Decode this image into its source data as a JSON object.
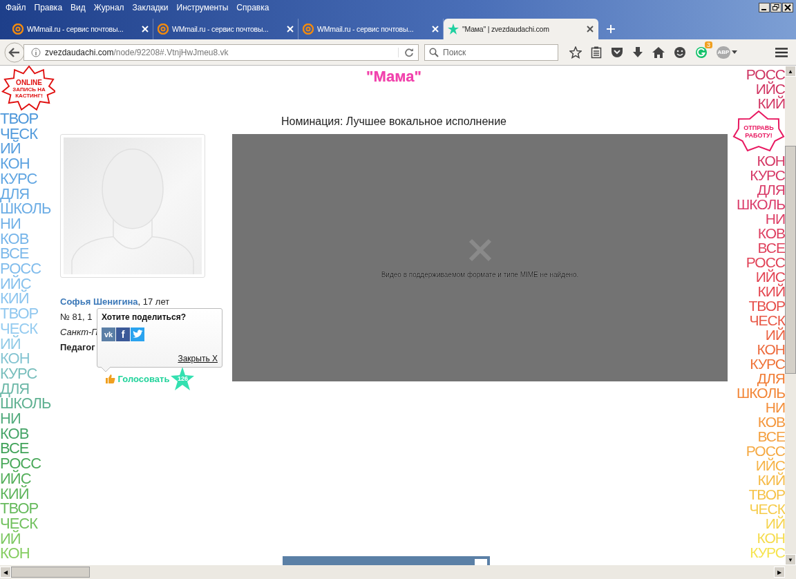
{
  "menu": [
    "Файл",
    "Правка",
    "Вид",
    "Журнал",
    "Закладки",
    "Инструменты",
    "Справка"
  ],
  "tabs": [
    {
      "title": "WMmail.ru - сервис почтовы...",
      "kind": "mail",
      "selected": false
    },
    {
      "title": "WMmail.ru - сервис почтовы...",
      "kind": "mail",
      "selected": false
    },
    {
      "title": "WMmail.ru - сервис почтовы...",
      "kind": "mail",
      "selected": false
    },
    {
      "title": "\"Мама\" | zvezdaudachi.com",
      "kind": "star",
      "selected": true
    }
  ],
  "address": {
    "host": "zvezdaudachi.com",
    "path": "/node/92208#.VtnjHwJmeu8.vk"
  },
  "search": {
    "placeholder": "Поиск"
  },
  "toolbar": {
    "grammar_badge": "3",
    "adblock_label": "ABP"
  },
  "scrollbars": {
    "up": "▲",
    "down": "▼",
    "left": "◀",
    "right": "▶"
  },
  "page": {
    "left_banner": {
      "lines": [
        "ТВОР",
        "ЧЕСК",
        "ИЙ",
        "КОН",
        "КУРС",
        "ДЛЯ",
        "ШКОЛЬ",
        "НИ",
        "КОВ",
        "ВСЕ",
        "РОСС",
        "ИЙС",
        "КИЙ",
        "ТВОР",
        "ЧЕСК",
        "ИЙ",
        "КОН",
        "КУРС",
        "ДЛЯ",
        "ШКОЛЬ",
        "НИ",
        "КОВ",
        "ВСЕ",
        "РОСС",
        "ИЙС",
        "КИЙ",
        "ТВОР",
        "ЧЕСК",
        "ИЙ",
        "КОН"
      ]
    },
    "casting_star": {
      "lines": [
        "ONLINE",
        "ЗАПИСЬ НА",
        "КАСТИНГ!"
      ]
    },
    "title": "\"Мама\"",
    "nomination": "Номинация: Лучшее вокальное исполнение",
    "author": {
      "name": "Софья Шенигина",
      "age": ", 17 лет",
      "school": "№ 81, 1",
      "city": "Санкт-П",
      "teacher": "Педагог"
    },
    "share_popup": {
      "title": "Хотите поделиться?",
      "networks": [
        {
          "kind": "vk",
          "label": "vk"
        },
        {
          "kind": "facebook",
          "label": "f"
        },
        {
          "kind": "twitter"
        }
      ],
      "close": "Закрыть X"
    },
    "vote": {
      "label": "Голосовать",
      "count": "126"
    },
    "video": {
      "message": "Видео в поддерживаемом формате и типе MIME не найдено."
    },
    "send_star": {
      "lines": [
        "ОТПРАВЬ",
        "РАБОТУ!"
      ]
    },
    "right_banner": {
      "top": [
        "РОСС",
        "ИЙС",
        "КИЙ"
      ],
      "bottom": [
        "КОН",
        "КУРС",
        "ДЛЯ",
        "ШКОЛЬ",
        "НИ",
        "КОВ",
        "ВСЕ",
        "РОСС",
        "ИЙС",
        "КИЙ",
        "ТВОР",
        "ЧЕСК",
        "ИЙ",
        "КОН",
        "КУРС",
        "ДЛЯ",
        "ШКОЛЬ",
        "НИ",
        "КОВ",
        "ВСЕ",
        "РОСС",
        "ИЙС",
        "КИЙ",
        "ТВОР",
        "ЧЕСК",
        "ИЙ",
        "КОН",
        "КУРС"
      ]
    }
  }
}
